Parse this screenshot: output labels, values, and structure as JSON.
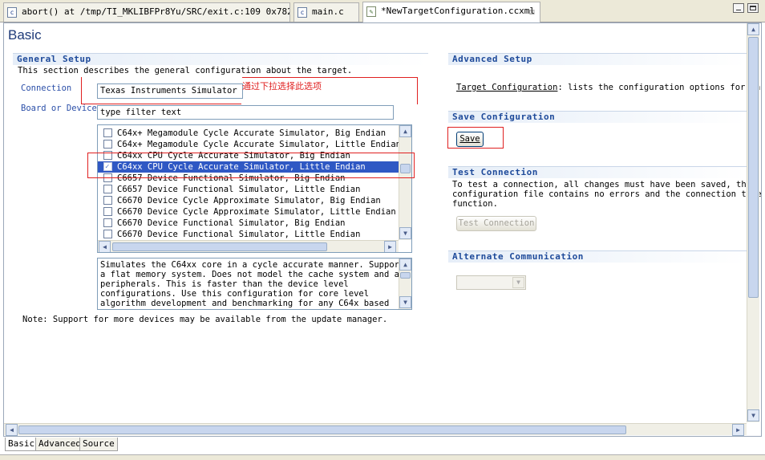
{
  "tabs": [
    {
      "label": "abort() at /tmp/TI_MKLIBFPr8Yu/SRC/exit.c:109 0x7820",
      "icon": "c-file-icon"
    },
    {
      "label": "main.c",
      "icon": "c-file-icon"
    },
    {
      "label": "*NewTargetConfiguration.ccxml",
      "icon": "config-file-icon"
    }
  ],
  "page_title": "Basic",
  "general_setup": {
    "heading": "General Setup",
    "description": "This section describes the general configuration about the target.",
    "connection_label": "Connection",
    "connection_value": "Texas Instruments Simulator",
    "board_label": "Board or Device",
    "filter_placeholder": "type filter text",
    "annotation": "通过下拉选择此选项",
    "devices": [
      {
        "label": "C64x+ Megamodule Cycle Accurate Simulator, Big Endian",
        "checked": false
      },
      {
        "label": "C64x+ Megamodule Cycle Accurate Simulator, Little Endian",
        "checked": false
      },
      {
        "label": "C64xx CPU Cycle Accurate Simulator, Big Endian",
        "checked": false
      },
      {
        "label": "C64xx CPU Cycle Accurate Simulator, Little Endian",
        "checked": true
      },
      {
        "label": "C6657 Device Functional Simulator, Big Endian",
        "checked": false
      },
      {
        "label": "C6657 Device Functional Simulator, Little Endian",
        "checked": false
      },
      {
        "label": "C6670 Device Cycle Approximate Simulator, Big Endian",
        "checked": false
      },
      {
        "label": "C6670 Device Cycle Approximate Simulator, Little Endian",
        "checked": false
      },
      {
        "label": "C6670 Device Functional Simulator, Big Endian",
        "checked": false
      },
      {
        "label": "C6670 Device Functional Simulator, Little Endian",
        "checked": false
      }
    ],
    "device_description": "Simulates the C64xx core in a cycle accurate manner. Supports\na flat memory system. Does not model the cache system and any\nperipherals. This is faster than the device level\nconfigurations. Use this configuration for core level\nalgorithm development and benchmarking for any C64x based",
    "note": "Note: Support for more devices may be available from the update manager."
  },
  "advanced_setup": {
    "heading": "Advanced Setup",
    "link": "Target Configuration",
    "text": ": lists the configuration options for th"
  },
  "save_configuration": {
    "heading": "Save Configuration",
    "button": "Save"
  },
  "test_connection": {
    "heading": "Test Connection",
    "text": "To test a connection, all changes must have been saved, the\nconfiguration file contains no errors and the connection type\nfunction.",
    "button": "Test Connection"
  },
  "alternate_communication": {
    "heading": "Alternate Communication"
  },
  "bottom_tabs": [
    "Basic",
    "Advanced",
    "Source"
  ],
  "colors": {
    "annotation_red": "#e02020",
    "heading_blue": "#1e4a9a",
    "selection": "#2f58c4"
  }
}
